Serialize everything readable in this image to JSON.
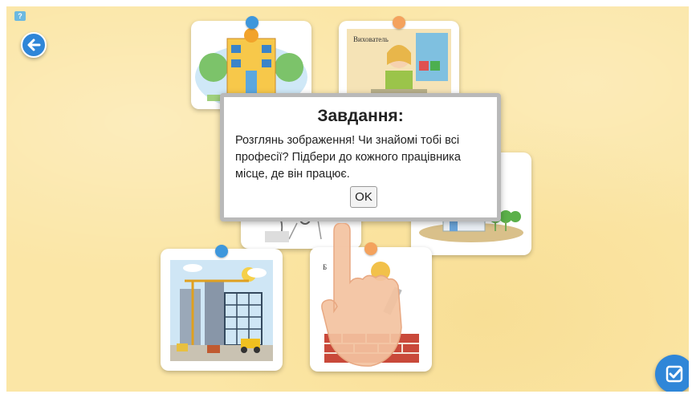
{
  "toolbar": {
    "help_icon": "question-icon",
    "back_icon": "arrow-left-icon",
    "check_icon": "check-icon"
  },
  "cards": [
    {
      "name": "kindergarten",
      "pin": "blue"
    },
    {
      "name": "teacher",
      "pin": "orange",
      "label": "Вихователь"
    },
    {
      "name": "doctor",
      "pin": "blue"
    },
    {
      "name": "hospital",
      "pin": "orange"
    },
    {
      "name": "construction-site",
      "pin": "blue"
    },
    {
      "name": "builder",
      "pin": "orange",
      "label": "Б"
    }
  ],
  "dialog": {
    "title": "Завдання:",
    "text": "Розглянь зображення! Чи знайомі тобі всі професії? Підбери до кожного працівника місце, де він працює.",
    "ok_label": "OK"
  },
  "colors": {
    "background": "#fbe6a6",
    "accent_blue": "#2f86d8",
    "pin_blue": "#3e97dc",
    "pin_orange": "#f4a25d"
  }
}
